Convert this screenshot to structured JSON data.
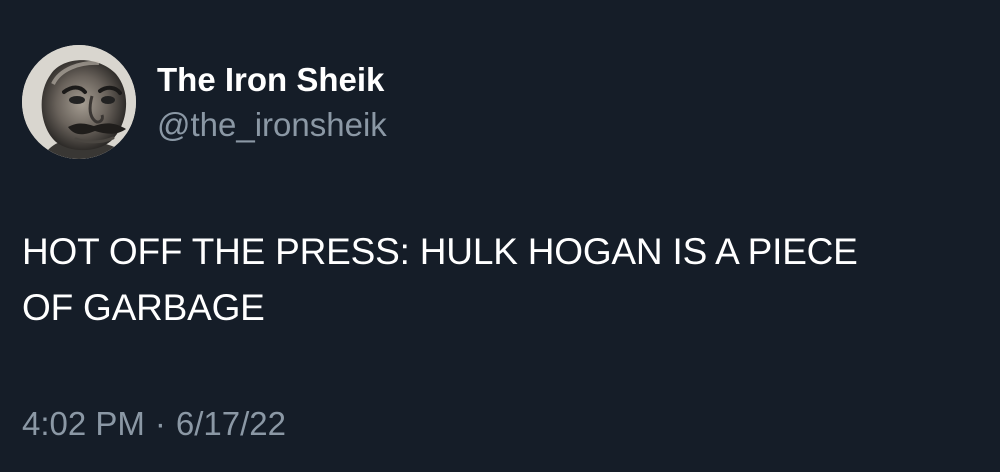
{
  "tweet": {
    "author": {
      "display_name": "The Iron Sheik",
      "handle": "@the_ironsheik",
      "avatar_icon": "profile-photo-avatar"
    },
    "text_lines": [
      "HOT OFF THE PRESS: HULK HOGAN IS A PIECE",
      "OF GARBAGE"
    ],
    "time": "4:02 PM",
    "separator": "·",
    "date": "6/17/22"
  },
  "colors": {
    "background": "#151d28",
    "primary_text": "#ffffff",
    "secondary_text": "#8b98a5"
  }
}
